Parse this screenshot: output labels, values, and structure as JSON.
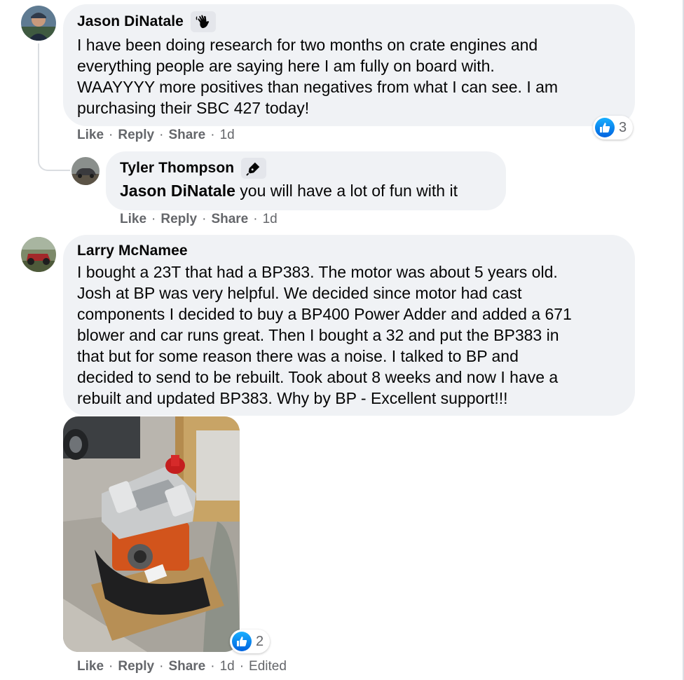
{
  "comments": [
    {
      "author": "Jason DiNatale",
      "badge_icon": "waving-hand-icon",
      "text": "I have been doing research for two months on crate engines and\neverything people are saying here I am fully on board with.\nWAAYYYY more positives than negatives from what I can see. I am\npurchasing their SBC 427 today!",
      "actions": {
        "like": "Like",
        "reply": "Reply",
        "share": "Share",
        "time": "1d"
      },
      "reaction_count": "3",
      "reply": {
        "author": "Tyler Thompson",
        "badge_icon": "pen-icon",
        "mention": "Jason DiNatale",
        "text": "you will have a lot of fun with it",
        "actions": {
          "like": "Like",
          "reply": "Reply",
          "share": "Share",
          "time": "1d"
        }
      }
    },
    {
      "author": "Larry McNamee",
      "text": "I bought a 23T that had a BP383. The motor was about 5 years old.\nJosh at BP was very helpful. We decided since motor had cast\ncomponents I decided to buy a BP400 Power Adder and added a 671\nblower and car runs great. Then I bought a 32 and put the BP383 in\nthat but for some reason there was a noise. I talked to BP and\ndecided to send to be rebuilt. Took about 8 weeks and now I have a\nrebuilt and updated BP383. Why by BP - Excellent support!!!",
      "actions": {
        "like": "Like",
        "reply": "Reply",
        "share": "Share",
        "time": "1d",
        "edited": "Edited"
      },
      "reaction_count": "2"
    }
  ],
  "separator": "·",
  "colors": {
    "bubble": "#f0f2f5",
    "secondary_text": "#65676b",
    "like_blue": "#1877f2"
  }
}
